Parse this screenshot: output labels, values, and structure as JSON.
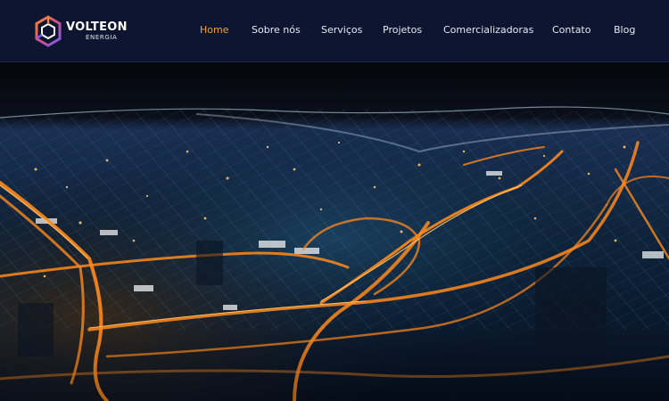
{
  "brand": {
    "name": "VOLTEON",
    "sub": "ENERGIA"
  },
  "nav": {
    "items": [
      {
        "label": "Home",
        "active": true
      },
      {
        "label": "Sobre nós",
        "active": false
      },
      {
        "label": "Serviços",
        "active": false
      },
      {
        "label": "Projetos",
        "active": false
      },
      {
        "label": "Comercializadoras",
        "active": false
      },
      {
        "label": "Contato",
        "active": false
      },
      {
        "label": "Blog",
        "active": false
      }
    ]
  },
  "colors": {
    "header_bg": "#0d1530",
    "nav_active": "#f2a23a",
    "nav_text": "#e6e9f2",
    "logo_gradient_start": "#f08a2a",
    "logo_gradient_end": "#7a5cf0"
  },
  "hero": {
    "image": "night-city-aerial-with-network-grid"
  }
}
